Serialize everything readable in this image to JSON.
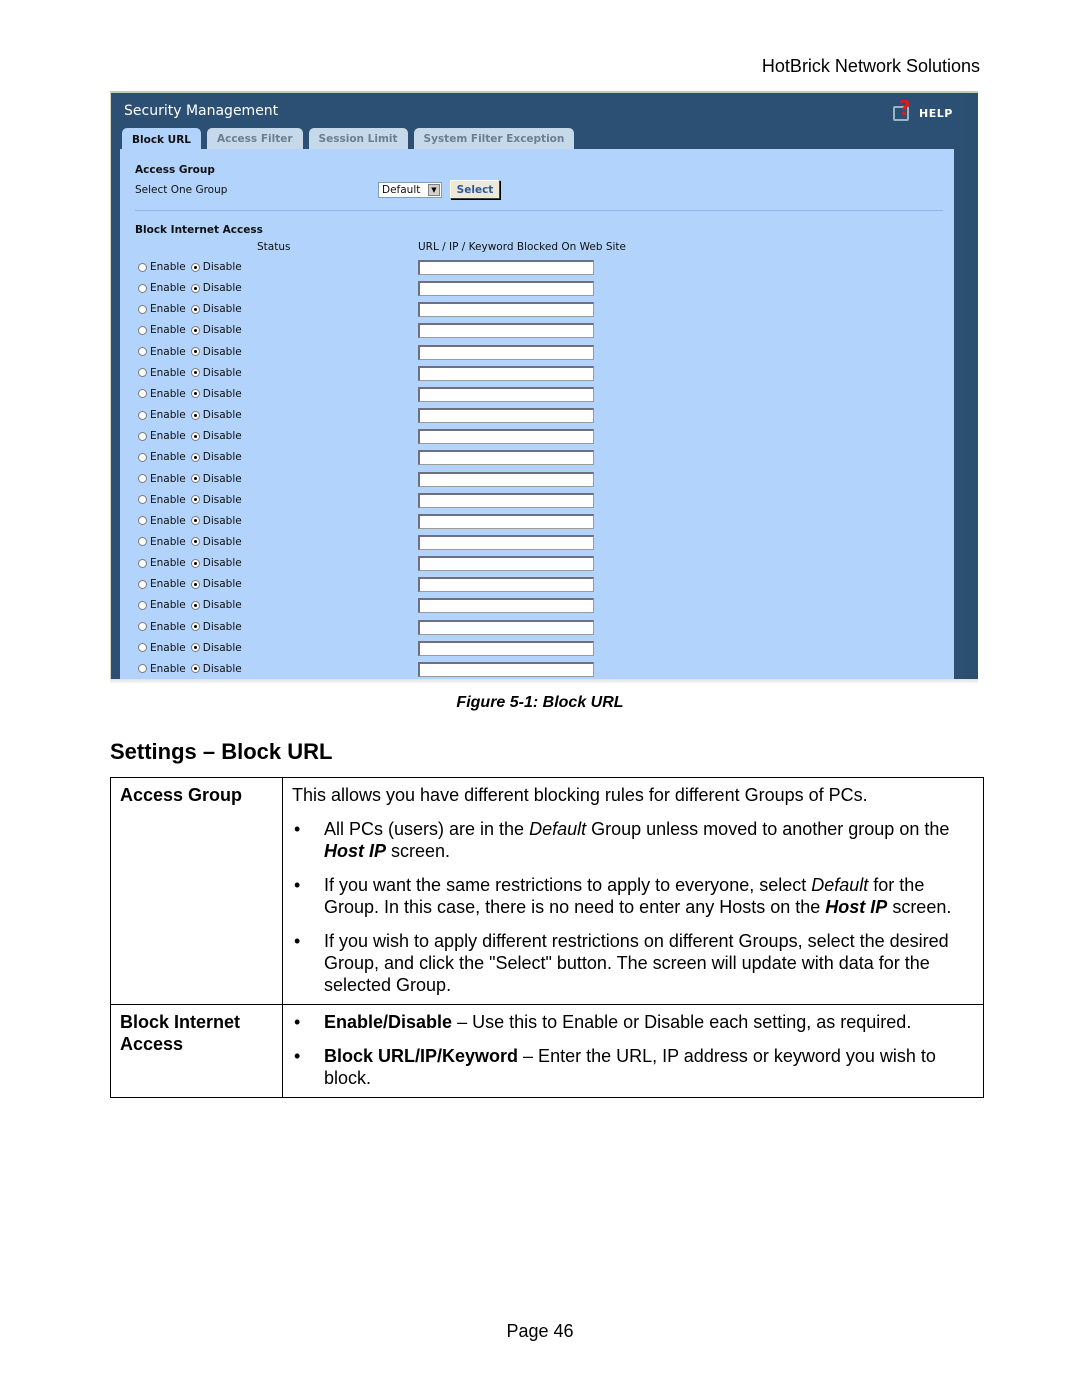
{
  "header": {
    "company": "HotBrick Network Solutions"
  },
  "app": {
    "title": "Security Management",
    "help_label": "HELP",
    "tabs": [
      {
        "label": "Block URL",
        "active": true
      },
      {
        "label": "Access Filter",
        "active": false
      },
      {
        "label": "Session Limit",
        "active": false
      },
      {
        "label": "System Filter Exception",
        "active": false
      }
    ],
    "access_group": {
      "title": "Access Group",
      "select_label": "Select One Group",
      "selected_group": "Default",
      "select_button": "Select"
    },
    "block_internet": {
      "title": "Block Internet Access",
      "status_header": "Status",
      "url_header": "URL / IP / Keyword Blocked On Web Site",
      "enable_label": "Enable",
      "disable_label": "Disable",
      "row_count": 20,
      "rows_status": [
        "Disable",
        "Disable",
        "Disable",
        "Disable",
        "Disable",
        "Disable",
        "Disable",
        "Disable",
        "Disable",
        "Disable",
        "Disable",
        "Disable",
        "Disable",
        "Disable",
        "Disable",
        "Disable",
        "Disable",
        "Disable",
        "Disable",
        "Disable"
      ],
      "rows_url": [
        "",
        "",
        "",
        "",
        "",
        "",
        "",
        "",
        "",
        "",
        "",
        "",
        "",
        "",
        "",
        "",
        "",
        "",
        "",
        ""
      ]
    },
    "colors": {
      "header_bg": "#2b5073",
      "panel_bg": "#b2d3fb",
      "help_question": "#e21818"
    }
  },
  "doc": {
    "caption": "Figure 5-1: Block URL",
    "heading": "Settings – Block URL",
    "table": {
      "access_group": {
        "key": "Access Group",
        "intro": "This allows you have different blocking rules for different Groups of PCs.",
        "b1_a": "All PCs (users) are in the ",
        "b1_em": "Default",
        "b1_b": " Group unless moved to another group on the ",
        "b1_strong": "Host IP",
        "b1_c": " screen.",
        "b2_a": "If you want the same restrictions to apply to everyone, select ",
        "b2_em": "Default",
        "b2_b": " for the Group. In this case, there is no need to enter any Hosts on the ",
        "b2_strong": "Host IP",
        "b2_c": " screen.",
        "b3": "If you wish to apply different restrictions on different Groups, select the desired Group, and click the \"Select\" button. The screen will update with data for the selected Group."
      },
      "block_internet": {
        "key": "Block Internet Access",
        "b1_strong": "Enable/Disable",
        "b1_rest": " – Use this to Enable or Disable each setting, as required.",
        "b2_strong": "Block URL/IP/Keyword",
        "b2_rest": " – Enter the URL, IP address or keyword you wish to block."
      }
    },
    "page": "Page 46"
  }
}
